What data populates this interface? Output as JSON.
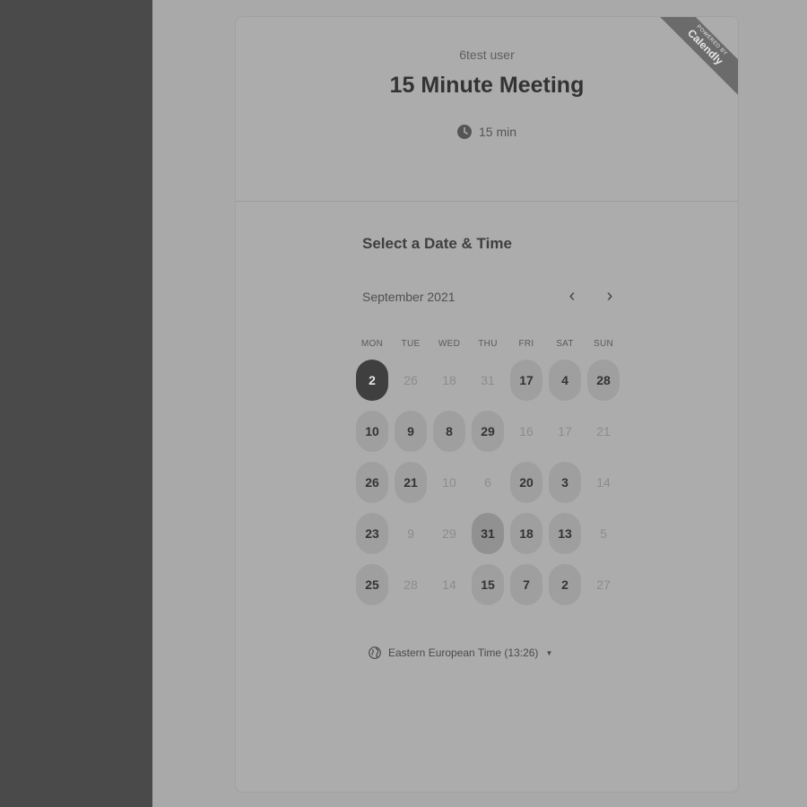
{
  "event": {
    "user_name": "6test user",
    "title": "15 Minute Meeting",
    "duration": "15 min"
  },
  "branding": {
    "powered_by": "POWERED BY",
    "brand": "Calendly"
  },
  "calendar": {
    "section_title": "Select a Date & Time",
    "month_label": "September 2021",
    "prev_icon": "chevron-left-icon",
    "next_icon": "chevron-right-icon",
    "weekdays": [
      "MON",
      "TUE",
      "WED",
      "THU",
      "FRI",
      "SAT",
      "SUN"
    ],
    "weeks": [
      [
        {
          "d": "2",
          "s": "selected"
        },
        {
          "d": "26",
          "s": "unavailable"
        },
        {
          "d": "18",
          "s": "unavailable"
        },
        {
          "d": "31",
          "s": "unavailable"
        },
        {
          "d": "17",
          "s": "available"
        },
        {
          "d": "4",
          "s": "available"
        },
        {
          "d": "28",
          "s": "available"
        }
      ],
      [
        {
          "d": "10",
          "s": "available"
        },
        {
          "d": "9",
          "s": "available"
        },
        {
          "d": "8",
          "s": "available"
        },
        {
          "d": "29",
          "s": "available"
        },
        {
          "d": "16",
          "s": "unavailable"
        },
        {
          "d": "17",
          "s": "unavailable"
        },
        {
          "d": "21",
          "s": "unavailable"
        }
      ],
      [
        {
          "d": "26",
          "s": "available"
        },
        {
          "d": "21",
          "s": "available"
        },
        {
          "d": "10",
          "s": "unavailable"
        },
        {
          "d": "6",
          "s": "unavailable"
        },
        {
          "d": "20",
          "s": "available"
        },
        {
          "d": "3",
          "s": "available"
        },
        {
          "d": "14",
          "s": "unavailable"
        }
      ],
      [
        {
          "d": "23",
          "s": "available"
        },
        {
          "d": "9",
          "s": "unavailable"
        },
        {
          "d": "29",
          "s": "unavailable"
        },
        {
          "d": "31",
          "s": "today"
        },
        {
          "d": "18",
          "s": "available"
        },
        {
          "d": "13",
          "s": "available"
        },
        {
          "d": "5",
          "s": "unavailable"
        }
      ],
      [
        {
          "d": "25",
          "s": "available"
        },
        {
          "d": "28",
          "s": "unavailable"
        },
        {
          "d": "14",
          "s": "unavailable"
        },
        {
          "d": "15",
          "s": "available"
        },
        {
          "d": "7",
          "s": "available"
        },
        {
          "d": "2",
          "s": "available"
        },
        {
          "d": "27",
          "s": "unavailable"
        }
      ]
    ]
  },
  "timezone": {
    "label": "Eastern European Time (13:26)",
    "icon": "globe-icon"
  }
}
